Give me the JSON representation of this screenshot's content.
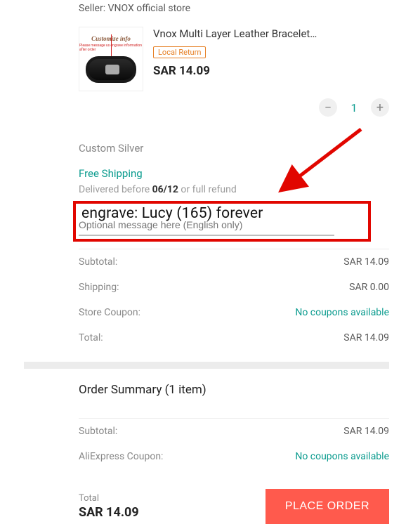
{
  "seller": {
    "prefix": "Seller:",
    "name": "VNOX official store"
  },
  "product": {
    "thumb_caption": "Customize info",
    "thumb_sub": "Please message us engrave information after order",
    "title": "Vnox Multi Layer Leather Bracelet…",
    "badge": "Local Return",
    "price": "SAR 14.09",
    "quantity": 1,
    "variant": "Custom Silver"
  },
  "shipping": {
    "free_label": "Free Shipping",
    "deliv_prefix": "Delivered before",
    "deliv_date": "06/12",
    "deliv_suffix": "or full refund"
  },
  "engrave": {
    "overlay_text": "engrave: Lucy (165) forever",
    "placeholder": "Optional message here (English only)"
  },
  "store_summary": {
    "rows": [
      {
        "label": "Subtotal:",
        "value": "SAR 14.09"
      },
      {
        "label": "Shipping:",
        "value": "SAR 0.00"
      },
      {
        "label": "Store Coupon:",
        "value": "No coupons available",
        "is_link": true
      },
      {
        "label": "Total:",
        "value": "SAR 14.09"
      }
    ]
  },
  "order_summary": {
    "title": "Order Summary (1 item)",
    "rows": [
      {
        "label": "Subtotal:",
        "value": "SAR 14.09"
      },
      {
        "label": "AliExpress Coupon:",
        "value": "No coupons available",
        "is_link": true
      }
    ]
  },
  "bottom": {
    "total_label": "Total",
    "total_value": "SAR 14.09",
    "place_order": "PLACE ORDER"
  },
  "icons": {
    "minus": "−",
    "plus": "+"
  },
  "colors": {
    "accent": "#0a9b8e",
    "highlight": "#e10600",
    "cta": "#ff5a4d"
  }
}
